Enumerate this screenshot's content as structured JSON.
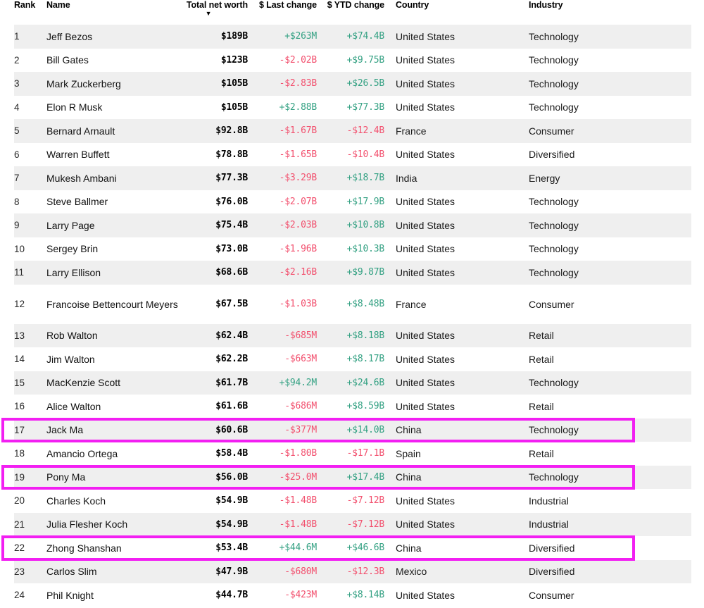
{
  "table": {
    "columns": [
      {
        "key": "rank",
        "label": "Rank",
        "align": "left",
        "type": "text"
      },
      {
        "key": "name",
        "label": "Name",
        "align": "left",
        "type": "text"
      },
      {
        "key": "networth",
        "label": "Total net worth",
        "align": "right",
        "type": "num",
        "sorted": true,
        "sort_direction": "desc",
        "sort_icon": "caret-down-icon"
      },
      {
        "key": "last",
        "label": "$ Last change",
        "align": "right",
        "type": "num"
      },
      {
        "key": "ytd",
        "label": "$ YTD change",
        "align": "right",
        "type": "num"
      },
      {
        "key": "country",
        "label": "Country",
        "align": "left",
        "type": "text"
      },
      {
        "key": "industry",
        "label": "Industry",
        "align": "left",
        "type": "text"
      }
    ],
    "sort_caret_glyph": "▼",
    "colors": {
      "positive": "#34a183",
      "negative": "#f2506e",
      "row_shade": "#efefef",
      "highlight_border": "#f21ff2",
      "text": "#1a1a1a"
    },
    "highlighted_ranks": [
      17,
      19,
      22
    ],
    "rows": [
      {
        "rank": "1",
        "name": "Jeff Bezos",
        "networth": "$189B",
        "last": "+$263M",
        "last_dir": "up",
        "ytd": "+$74.4B",
        "ytd_dir": "up",
        "country": "United States",
        "industry": "Technology"
      },
      {
        "rank": "2",
        "name": "Bill Gates",
        "networth": "$123B",
        "last": "-$2.02B",
        "last_dir": "down",
        "ytd": "+$9.75B",
        "ytd_dir": "up",
        "country": "United States",
        "industry": "Technology"
      },
      {
        "rank": "3",
        "name": "Mark Zuckerberg",
        "networth": "$105B",
        "last": "-$2.83B",
        "last_dir": "down",
        "ytd": "+$26.5B",
        "ytd_dir": "up",
        "country": "United States",
        "industry": "Technology"
      },
      {
        "rank": "4",
        "name": "Elon R Musk",
        "networth": "$105B",
        "last": "+$2.88B",
        "last_dir": "up",
        "ytd": "+$77.3B",
        "ytd_dir": "up",
        "country": "United States",
        "industry": "Technology"
      },
      {
        "rank": "5",
        "name": "Bernard Arnault",
        "networth": "$92.8B",
        "last": "-$1.67B",
        "last_dir": "down",
        "ytd": "-$12.4B",
        "ytd_dir": "down",
        "country": "France",
        "industry": "Consumer"
      },
      {
        "rank": "6",
        "name": "Warren Buffett",
        "networth": "$78.8B",
        "last": "-$1.65B",
        "last_dir": "down",
        "ytd": "-$10.4B",
        "ytd_dir": "down",
        "country": "United States",
        "industry": "Diversified"
      },
      {
        "rank": "7",
        "name": "Mukesh Ambani",
        "networth": "$77.3B",
        "last": "-$3.29B",
        "last_dir": "down",
        "ytd": "+$18.7B",
        "ytd_dir": "up",
        "country": "India",
        "industry": "Energy"
      },
      {
        "rank": "8",
        "name": "Steve Ballmer",
        "networth": "$76.0B",
        "last": "-$2.07B",
        "last_dir": "down",
        "ytd": "+$17.9B",
        "ytd_dir": "up",
        "country": "United States",
        "industry": "Technology"
      },
      {
        "rank": "9",
        "name": "Larry Page",
        "networth": "$75.4B",
        "last": "-$2.03B",
        "last_dir": "down",
        "ytd": "+$10.8B",
        "ytd_dir": "up",
        "country": "United States",
        "industry": "Technology"
      },
      {
        "rank": "10",
        "name": "Sergey Brin",
        "networth": "$73.0B",
        "last": "-$1.96B",
        "last_dir": "down",
        "ytd": "+$10.3B",
        "ytd_dir": "up",
        "country": "United States",
        "industry": "Technology"
      },
      {
        "rank": "11",
        "name": "Larry Ellison",
        "networth": "$68.6B",
        "last": "-$2.16B",
        "last_dir": "down",
        "ytd": "+$9.87B",
        "ytd_dir": "up",
        "country": "United States",
        "industry": "Technology"
      },
      {
        "rank": "12",
        "name": "Francoise Bettencourt Meyers",
        "networth": "$67.5B",
        "last": "-$1.03B",
        "last_dir": "down",
        "ytd": "+$8.48B",
        "ytd_dir": "up",
        "country": "France",
        "industry": "Consumer",
        "tall": true
      },
      {
        "rank": "13",
        "name": "Rob Walton",
        "networth": "$62.4B",
        "last": "-$685M",
        "last_dir": "down",
        "ytd": "+$8.18B",
        "ytd_dir": "up",
        "country": "United States",
        "industry": "Retail"
      },
      {
        "rank": "14",
        "name": "Jim Walton",
        "networth": "$62.2B",
        "last": "-$663M",
        "last_dir": "down",
        "ytd": "+$8.17B",
        "ytd_dir": "up",
        "country": "United States",
        "industry": "Retail"
      },
      {
        "rank": "15",
        "name": "MacKenzie Scott",
        "networth": "$61.7B",
        "last": "+$94.2M",
        "last_dir": "up",
        "ytd": "+$24.6B",
        "ytd_dir": "up",
        "country": "United States",
        "industry": "Technology"
      },
      {
        "rank": "16",
        "name": "Alice Walton",
        "networth": "$61.6B",
        "last": "-$686M",
        "last_dir": "down",
        "ytd": "+$8.59B",
        "ytd_dir": "up",
        "country": "United States",
        "industry": "Retail"
      },
      {
        "rank": "17",
        "name": "Jack Ma",
        "networth": "$60.6B",
        "last": "-$377M",
        "last_dir": "down",
        "ytd": "+$14.0B",
        "ytd_dir": "up",
        "country": "China",
        "industry": "Technology"
      },
      {
        "rank": "18",
        "name": "Amancio Ortega",
        "networth": "$58.4B",
        "last": "-$1.80B",
        "last_dir": "down",
        "ytd": "-$17.1B",
        "ytd_dir": "down",
        "country": "Spain",
        "industry": "Retail"
      },
      {
        "rank": "19",
        "name": "Pony Ma",
        "networth": "$56.0B",
        "last": "-$25.0M",
        "last_dir": "down",
        "ytd": "+$17.4B",
        "ytd_dir": "up",
        "country": "China",
        "industry": "Technology"
      },
      {
        "rank": "20",
        "name": "Charles Koch",
        "networth": "$54.9B",
        "last": "-$1.48B",
        "last_dir": "down",
        "ytd": "-$7.12B",
        "ytd_dir": "down",
        "country": "United States",
        "industry": "Industrial"
      },
      {
        "rank": "21",
        "name": "Julia Flesher Koch",
        "networth": "$54.9B",
        "last": "-$1.48B",
        "last_dir": "down",
        "ytd": "-$7.12B",
        "ytd_dir": "down",
        "country": "United States",
        "industry": "Industrial"
      },
      {
        "rank": "22",
        "name": "Zhong Shanshan",
        "networth": "$53.4B",
        "last": "+$44.6M",
        "last_dir": "up",
        "ytd": "+$46.6B",
        "ytd_dir": "up",
        "country": "China",
        "industry": "Diversified"
      },
      {
        "rank": "23",
        "name": "Carlos Slim",
        "networth": "$47.9B",
        "last": "-$680M",
        "last_dir": "down",
        "ytd": "-$12.3B",
        "ytd_dir": "down",
        "country": "Mexico",
        "industry": "Diversified"
      },
      {
        "rank": "24",
        "name": "Phil Knight",
        "networth": "$44.7B",
        "last": "-$423M",
        "last_dir": "down",
        "ytd": "+$8.14B",
        "ytd_dir": "up",
        "country": "United States",
        "industry": "Consumer"
      }
    ]
  }
}
